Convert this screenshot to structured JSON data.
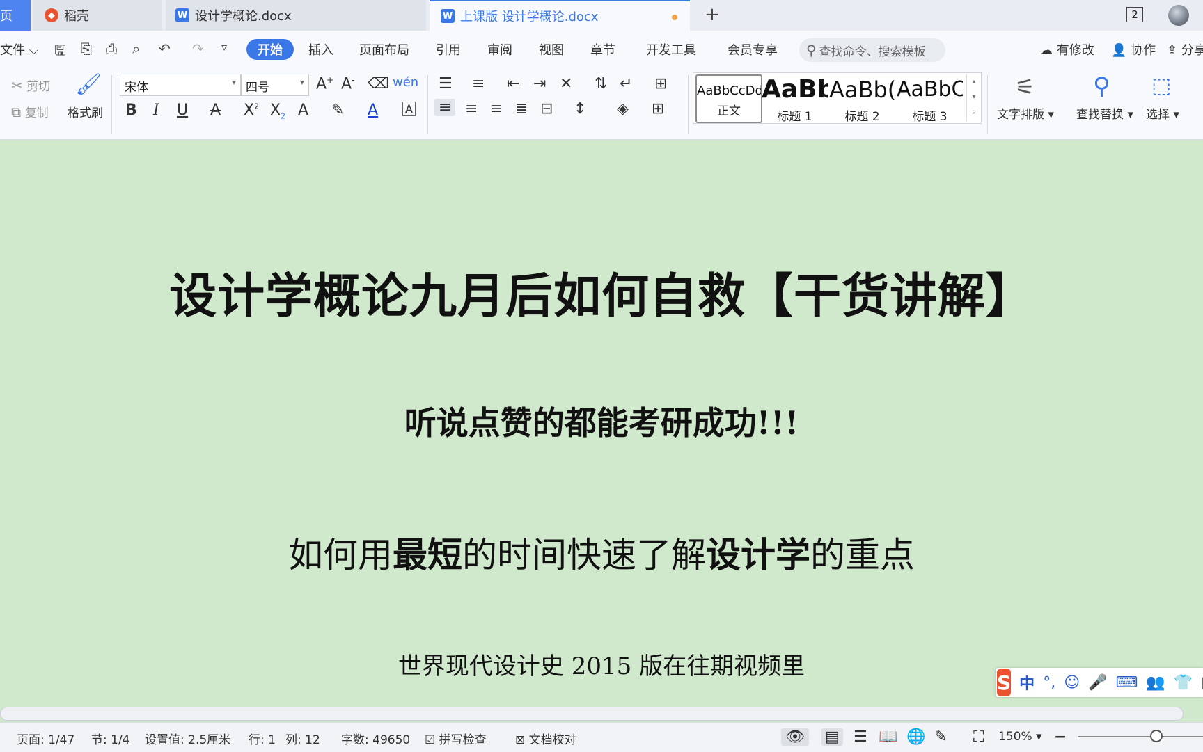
{
  "colors": {
    "accent": "#3a78e8",
    "page_bg": "#d0e8cc",
    "ime_logo": "#e9532f"
  },
  "tabs": {
    "home": {
      "label": "页"
    },
    "daoke": {
      "label": "稻壳"
    },
    "doc1": {
      "label": "设计学概论.docx"
    },
    "doc2": {
      "label": "上课版 设计学概论.docx"
    },
    "new_tab_label": "+",
    "window_count": "2"
  },
  "menu": {
    "file": "文件",
    "items": [
      "开始",
      "插入",
      "页面布局",
      "引用",
      "审阅",
      "视图",
      "章节",
      "开发工具",
      "会员专享"
    ],
    "search_placeholder": "查找命令、搜索模板",
    "has_changes": "有修改",
    "collab": "协作",
    "share": "分享"
  },
  "ribbon": {
    "cut": "剪切",
    "copy": "复制",
    "format_painter": "格式刷",
    "font_name": "宋体",
    "font_size": "四号",
    "styles": [
      {
        "preview": "AaBbCcDd",
        "name": "正文"
      },
      {
        "preview": "AaBb",
        "name": "标题 1"
      },
      {
        "preview": "AaBb(",
        "name": "标题 2"
      },
      {
        "preview": "AaBbC",
        "name": "标题 3"
      }
    ],
    "text_layout": "文字排版",
    "find_replace": "查找替换",
    "select": "选择"
  },
  "document": {
    "title": "设计学概论九月后如何自救【干货讲解】",
    "subtitle": "听说点赞的都能考研成功!!!",
    "line3_parts": [
      "如何用",
      "最短",
      "的时间快速了解",
      "设计学",
      "的重点"
    ],
    "line4": "世界现代设计史 2015 版在往期视频里"
  },
  "ime": {
    "logo": "S",
    "mode": "中",
    "punct": "°,"
  },
  "status": {
    "page": "页面: 1/47",
    "section": "节: 1/4",
    "setting": "设置值: 2.5厘米",
    "row": "行: 1",
    "col": "列: 12",
    "words": "字数: 49650",
    "spell": "拼写检查",
    "proof": "文档校对",
    "zoom": "150%",
    "zoom_level": 1.5
  },
  "icons": [
    "home-icon",
    "daoke-logo-icon",
    "word-doc-icon",
    "plus-icon",
    "window-icon",
    "avatar",
    "save-icon",
    "undo-icon",
    "redo-icon",
    "print-icon",
    "search-icon",
    "cloud-icon",
    "user-plus-icon",
    "share-icon",
    "scissors-icon",
    "copy-icon",
    "brush-icon",
    "bold-icon",
    "italic-icon",
    "underline-icon",
    "eye-icon",
    "zoom-out-icon"
  ]
}
